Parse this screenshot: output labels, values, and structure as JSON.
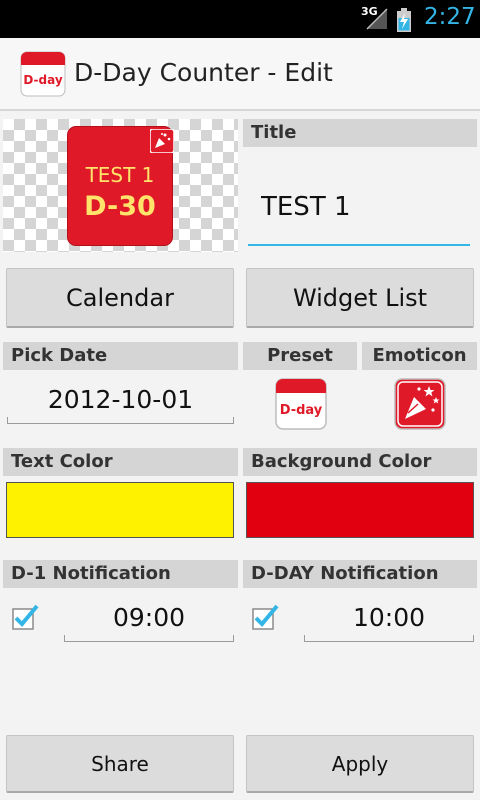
{
  "status_bar": {
    "network": "3G",
    "time": "2:27"
  },
  "header": {
    "app_icon_text": "D-day",
    "title": "D-Day Counter - Edit"
  },
  "preview": {
    "widget_title": "TEST 1",
    "widget_count": "D-30"
  },
  "title_section": {
    "label": "Title",
    "value": "TEST 1"
  },
  "buttons": {
    "calendar": "Calendar",
    "widget_list": "Widget List",
    "share": "Share",
    "apply": "Apply"
  },
  "pick_date": {
    "label": "Pick Date",
    "value": "2012-10-01"
  },
  "preset": {
    "label": "Preset",
    "icon_text": "D-day"
  },
  "emoticon": {
    "label": "Emoticon"
  },
  "text_color": {
    "label": "Text Color",
    "value": "#fff200"
  },
  "background_color": {
    "label": "Background Color",
    "value": "#e10010"
  },
  "d1_notification": {
    "label": "D-1 Notification",
    "checked": true,
    "time": "09:00"
  },
  "dday_notification": {
    "label": "D-DAY Notification",
    "checked": true,
    "time": "10:00"
  }
}
